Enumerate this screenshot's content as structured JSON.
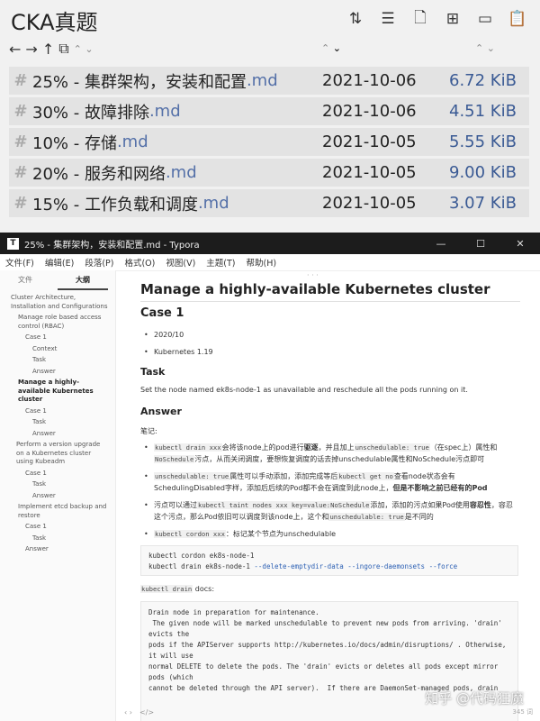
{
  "browser": {
    "title": "CKA真题",
    "toolbar_icons": [
      "sort-icon",
      "list-icon",
      "new-file-icon",
      "new-folder-icon",
      "folder-icon",
      "paste-icon"
    ],
    "nav": {
      "back": "←",
      "forward": "→",
      "up": "↑"
    },
    "files": [
      {
        "name": "25% - 集群架构，安装和配置",
        "ext": ".md",
        "date": "2021-10-06",
        "size": "6.72 KiB"
      },
      {
        "name": "30% - 故障排除",
        "ext": ".md",
        "date": "2021-10-06",
        "size": "4.51 KiB"
      },
      {
        "name": "10% - 存储",
        "ext": ".md",
        "date": "2021-10-05",
        "size": "5.55 KiB"
      },
      {
        "name": "20% - 服务和网络",
        "ext": ".md",
        "date": "2021-10-05",
        "size": "9.00 KiB"
      },
      {
        "name": "15% - 工作负载和调度",
        "ext": ".md",
        "date": "2021-10-05",
        "size": "3.07 KiB"
      }
    ]
  },
  "typora": {
    "window_title": "25% - 集群架构，安装和配置.md - Typora",
    "menu": [
      "文件(F)",
      "编辑(E)",
      "段落(P)",
      "格式(O)",
      "视图(V)",
      "主题(T)",
      "帮助(H)"
    ],
    "sidebar_tabs": [
      "文件",
      "大纲"
    ],
    "outline": [
      {
        "text": "Cluster Architecture, Installation and Configurations",
        "level": 1
      },
      {
        "text": "Manage role based access control (RBAC)",
        "level": 2
      },
      {
        "text": "Case 1",
        "level": 3
      },
      {
        "text": "Context",
        "level": 4
      },
      {
        "text": "Task",
        "level": 4
      },
      {
        "text": "Answer",
        "level": 4
      },
      {
        "text": "Manage a highly-available Kubernetes cluster",
        "level": 2,
        "active": true
      },
      {
        "text": "Case 1",
        "level": 3
      },
      {
        "text": "Task",
        "level": 4
      },
      {
        "text": "Answer",
        "level": 4
      },
      {
        "text": "Perform a version upgrade on a Kubernetes cluster using Kubeadm",
        "level": 2
      },
      {
        "text": "Case 1",
        "level": 3
      },
      {
        "text": "Task",
        "level": 4
      },
      {
        "text": "Answer",
        "level": 4
      },
      {
        "text": "Implement etcd backup and restore",
        "level": 2
      },
      {
        "text": "Case 1",
        "level": 3
      },
      {
        "text": "Task",
        "level": 4
      },
      {
        "text": "Answer",
        "level": 3
      }
    ],
    "doc": {
      "h1": "Manage a highly-available Kubernetes cluster",
      "case": "Case 1",
      "case_items": [
        "2020/10",
        "Kubernetes 1.19"
      ],
      "task_h": "Task",
      "task_text": "Set the node named ek8s-node-1 as unavailable and reschedule all the pods running on it.",
      "answer_h": "Answer",
      "notes_label": "笔记:",
      "b1_code1": "kubectl drain xxx",
      "b1_t1": "会将该node上的pod进行",
      "b1_bold1": "驱逐",
      "b1_t2": "，并且加上",
      "b1_code2": "unschedulable: true",
      "b1_t3": "（在spec上）属性和",
      "b1_code3": "NoSchedule",
      "b1_t4": "污点，从而关闭调度，要想恢复调度的话去掉unschedulable属性和NoSchedule污点即可",
      "b2_code1": "unschedulable: true",
      "b2_t1": "属性可以手动添加，添加完成等后",
      "b2_code2": "kubectl get no",
      "b2_t2": "查看node状态会有SchedulingDisabled字样，添加后后续的Pod都不会在调度到此node上，",
      "b2_bold": "但是不影响之前已经有的Pod",
      "b3_t1": "污点可以通过",
      "b3_code1": "kubectl taint nodes xxx key=value:NoSchedule",
      "b3_t2": "添加，添加的污点如果Pod使用",
      "b3_bold": "容忍性",
      "b3_t3": "，容忍这个污点，那么Pod依旧可以调度到该node上，这个和",
      "b3_code2": "unschedulable: true",
      "b3_t4": "是不同的",
      "b4_code": "kubectl cordon xxx",
      "b4_t": "：标记某个节点为unschedulable",
      "cmd1": "kubectl cordon ek8s-node-1",
      "cmd2_a": "kubectl drain ek8s-node-1 ",
      "cmd2_b": "--delete-emptydir-data --ingore-daemonsets --force",
      "docs_code": "kubectl drain",
      "docs_suffix": " docs:",
      "help_lines": [
        "Drain node in preparation for maintenance.",
        "",
        " The given node will be marked unschedulable to prevent new pods from arriving. 'drain'",
        "evicts the",
        "pods if the APIServer supports http://kubernetes.io/docs/admin/disruptions/ . Otherwise,",
        "it will use",
        "normal DELETE to delete the pods. The 'drain' evicts or deletes all pods except mirror",
        "pods (which",
        "cannot be deleted through the API server).  If there are DaemonSet-managed pods, drain"
      ],
      "word_count": "345 词"
    },
    "status": {
      "left": "‹ ›",
      "code": "</>"
    },
    "watermark": "知乎 @代码狂魔"
  },
  "colors": {
    "row_bg": "#e3e3e3",
    "ext": "#5470a8",
    "size": "#3a5a94",
    "titlebar": "#1c1c1c"
  }
}
